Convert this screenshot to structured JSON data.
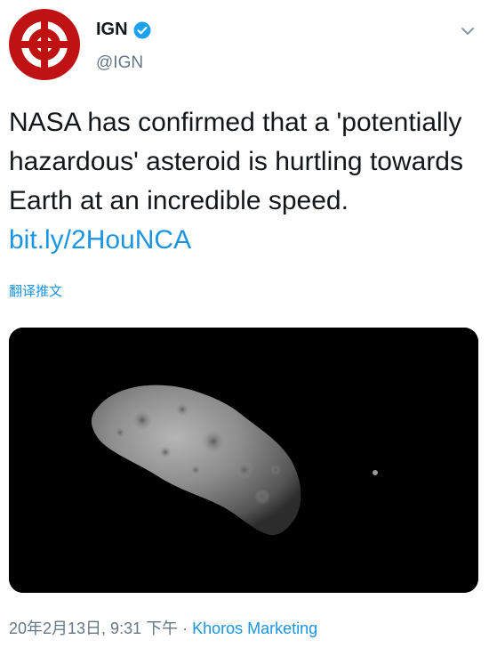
{
  "tweet": {
    "display_name": "IGN",
    "handle": "@IGN",
    "text": "NASA has confirmed that a 'potentially hazardous' asteroid is hurtling towards Earth at an incredible speed. ",
    "link": "bit.ly/2HouNCA",
    "translate_label": "翻译推文",
    "timestamp": "20年2月13日, 9:31 下午",
    "separator": " · ",
    "source": "Khoros Marketing"
  },
  "icons": {
    "avatar": "ign-logo-icon",
    "verified": "verified-badge-icon",
    "menu": "chevron-down-icon"
  },
  "colors": {
    "brand_red": "#bf1313",
    "link_blue": "#1b95e0",
    "verified_blue": "#1da1f2",
    "muted": "#657786"
  }
}
